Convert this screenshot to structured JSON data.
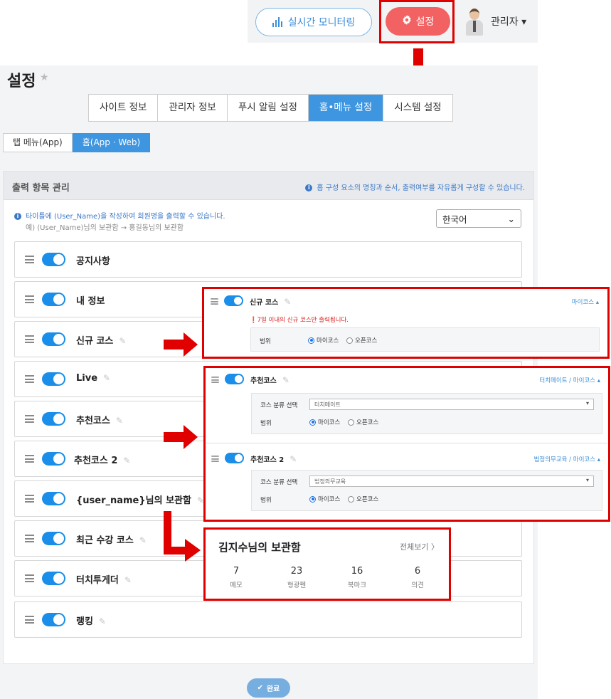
{
  "header": {
    "monitor_label": "실시간 모니터링",
    "settings_label": "설정",
    "user_label": "관리자 ▾",
    "accent": "#f26262",
    "highlight": "#e00000"
  },
  "page": {
    "title": "설정",
    "star": "★"
  },
  "tabs": [
    "사이트 정보",
    "관리자 정보",
    "푸시 알림 설정",
    "홈•메뉴 설정",
    "시스템 설정"
  ],
  "subtabs": [
    "탭 메뉴(App)",
    "홈(App · Web)"
  ],
  "panel": {
    "title": "출력 항목 관리",
    "help": "홈 구성 요소의 명칭과 순서, 출력여부를 자유롭게 구성할 수 있습니다.",
    "info1": "타이틀에 (User_Name)을 작성하여 회원명을 출력할 수 있습니다.",
    "info2": "예) (User_Name)님의 보관함 → 홍길동님의 보관함",
    "language": "한국어",
    "items": [
      "공지사항",
      "내 정보",
      "신규 코스",
      "Live",
      "추천코스",
      "추천코스 2",
      "{user_name}님의 보관함",
      "최근 수강 코스",
      "터치투게더",
      "랭킹"
    ]
  },
  "detail_new": {
    "title": "신규 코스",
    "right": "마이코스 ▴",
    "warning": "7일 이내의 신규 코스만 출력됩니다.",
    "range_label": "범위",
    "opt_my": "마이코스",
    "opt_open": "오픈코스"
  },
  "detail_rec1": {
    "title": "추천코스",
    "right": "터치메이트 / 마이코스 ▴",
    "category_label": "코스 분류 선택",
    "category_value": "터치메이트",
    "range_label": "범위",
    "opt_my": "마이코스",
    "opt_open": "오픈코스"
  },
  "detail_rec2": {
    "title": "추천코스 2",
    "right": "법정의무교육 / 마이코스 ▴",
    "category_label": "코스 분류 선택",
    "category_value": "법정의무교육",
    "range_label": "범위",
    "opt_my": "마이코스",
    "opt_open": "오픈코스"
  },
  "storage": {
    "title": "김지수님의 보관함",
    "more": "전체보기 〉",
    "stats": [
      {
        "num": "7",
        "label": "메모"
      },
      {
        "num": "23",
        "label": "형광펜"
      },
      {
        "num": "16",
        "label": "북마크"
      },
      {
        "num": "6",
        "label": "의견"
      }
    ]
  },
  "done_label": "완료"
}
